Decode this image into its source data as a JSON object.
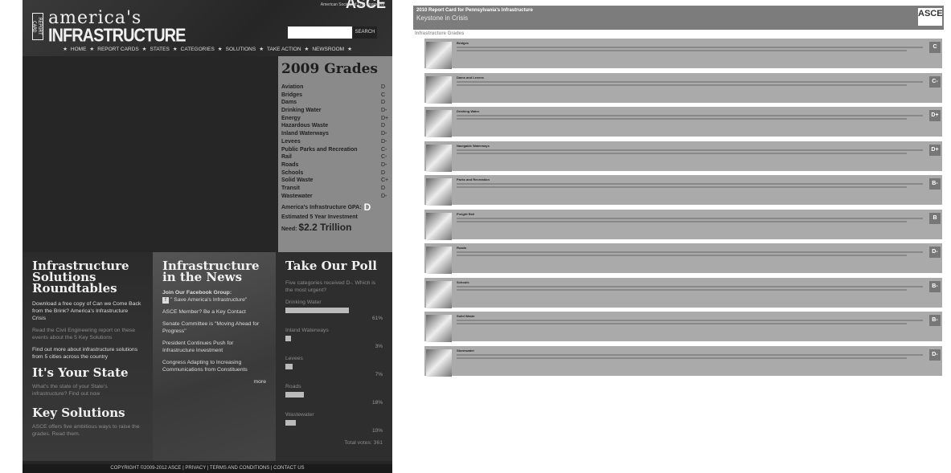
{
  "left": {
    "header": {
      "logo_report": "REPORT CARD",
      "logo_americas": "america's",
      "logo_infra": "INFRASTRUCTURE",
      "asce": "ASCE",
      "asce_sub": "American Society of Civil Engineers",
      "search_button": "SEARCH",
      "nav": [
        "HOME",
        "REPORT CARDS",
        "STATES",
        "CATEGORIES",
        "SOLUTIONS",
        "TAKE ACTION",
        "NEWSROOM"
      ]
    },
    "grades": {
      "title": "2009 Grades",
      "items": [
        {
          "name": "Aviation",
          "grade": "D"
        },
        {
          "name": "Bridges",
          "grade": "C"
        },
        {
          "name": "Dams",
          "grade": "D"
        },
        {
          "name": "Drinking Water",
          "grade": "D-"
        },
        {
          "name": "Energy",
          "grade": "D+"
        },
        {
          "name": "Hazardous Waste",
          "grade": "D"
        },
        {
          "name": "Inland Waterways",
          "grade": "D-"
        },
        {
          "name": "Levees",
          "grade": "D-"
        },
        {
          "name": "Public Parks and Recreation",
          "grade": "C-"
        },
        {
          "name": "Rail",
          "grade": "C-"
        },
        {
          "name": "Roads",
          "grade": "D-"
        },
        {
          "name": "Schools",
          "grade": "D"
        },
        {
          "name": "Solid Waste",
          "grade": "C+"
        },
        {
          "name": "Transit",
          "grade": "D"
        },
        {
          "name": "Wastewater",
          "grade": "D-"
        }
      ],
      "gpa_label": "America's Infrastructure GPA:",
      "gpa_value": "D",
      "investment_label": "Estimated 5 Year Investment",
      "need_label": "Need:",
      "need_value": "$2.2 Trillion"
    },
    "col1": {
      "title": "Infrastructure Solutions Roundtables",
      "p1": "Download a free copy of Can we Come Back from the Brink? America's Infrastructure Crisis",
      "p2": "Read the Civil Engineering report on these events about the 5 Key Solutions",
      "p3": "Find out more about infrastructure solutions from 5 cities across the country",
      "title2": "It's Your State",
      "p4": "What's the state of your State's infrastructure? Find out now",
      "title3": "Key Solutions",
      "p5": "ASCE offers five ambitious ways to raise the grades. Read them."
    },
    "col2": {
      "title": "Infrastructure in the News",
      "fb_label": "Join Our Facebook Group:",
      "fb_group": "\" Save America's Infrastructure\"",
      "items": [
        "ASCE Member? Be a Key Contact",
        "Senate Committee is \"Moving Ahead for Progress\"",
        "President Continues Push for Infrastructure Investment",
        "Congress Adapting to Increasing Communications from Constituents"
      ],
      "more": "more"
    },
    "col3": {
      "title": "Take Our Poll",
      "question": "Five categories received D-. Which is the most urgent?",
      "options": [
        {
          "label": "Drinking Water",
          "pct": "61%",
          "value": 61
        },
        {
          "label": "Inland Waterways",
          "pct": "3%",
          "value": 3
        },
        {
          "label": "Levees",
          "pct": "7%",
          "value": 7
        },
        {
          "label": "Roads",
          "pct": "18%",
          "value": 18
        },
        {
          "label": "Wastewater",
          "pct": "10%",
          "value": 10
        }
      ],
      "total": "Total votes: 361"
    },
    "footer": "COPYRIGHT ©2009-2012 ASCE  |  PRIVACY  |  TERMS AND CONDITIONS  |  CONTACT US"
  },
  "right": {
    "title": "2010 Report Card for Pennsylvania's Infrastructure",
    "subtitle": "Keystone in Crisis",
    "asce": "ASCE",
    "section": "Infrastructure Grades",
    "rows": [
      {
        "cat": "Bridges",
        "grade": "C"
      },
      {
        "cat": "Dams and Levees",
        "grade": "C-"
      },
      {
        "cat": "Drinking Water",
        "grade": "D+"
      },
      {
        "cat": "Navigable Waterways",
        "grade": "D+"
      },
      {
        "cat": "Parks and Recreation",
        "grade": "B-"
      },
      {
        "cat": "Freight Rail",
        "grade": "B"
      },
      {
        "cat": "Roads",
        "grade": "D-"
      },
      {
        "cat": "Schools",
        "grade": "B-"
      },
      {
        "cat": "Solid Waste",
        "grade": "B-"
      },
      {
        "cat": "Stormwater",
        "grade": "D-"
      }
    ]
  }
}
